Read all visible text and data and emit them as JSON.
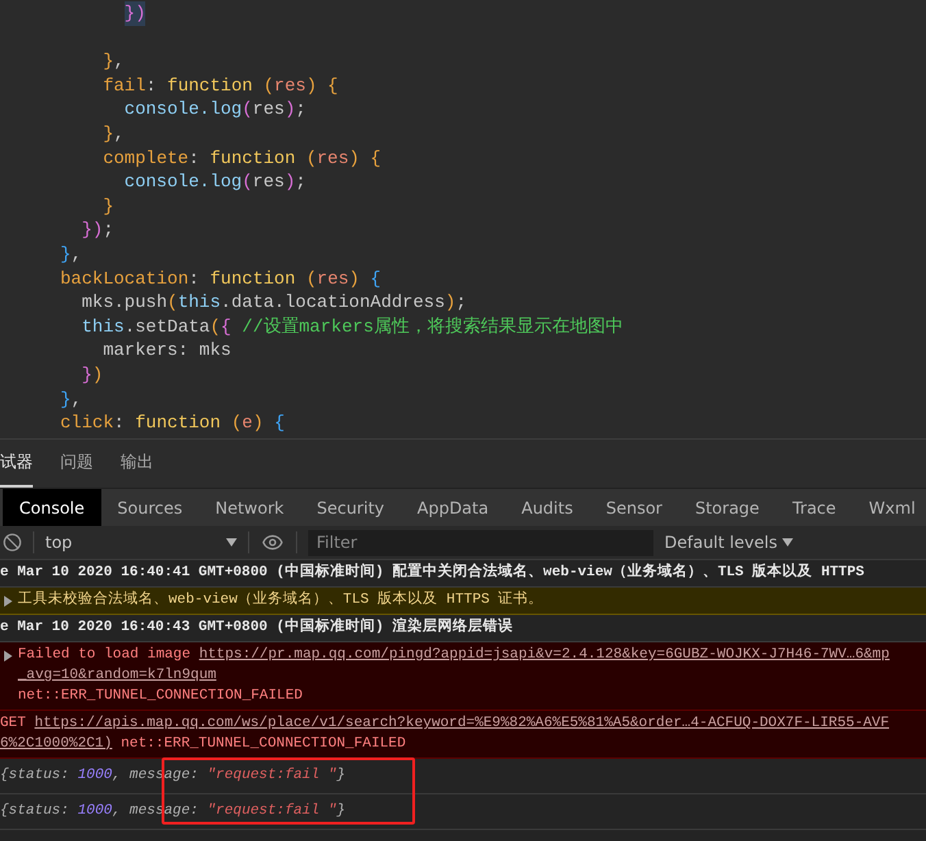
{
  "editor": {
    "lines": [
      {
        "kind": "group",
        "children": [
          {
            "kind": "group",
            "children": [
              {
                "kind": "group",
                "children": [
                  {
                    "kind": "code",
                    "highlighted": true,
                    "tokens": [
                      {
                        "kind": "bracket2",
                        "text": "})"
                      }
                    ]
                  }
                ]
              },
              {
                "kind": "blank"
              },
              {
                "kind": "code",
                "tokens": [
                  {
                    "kind": "bracket1",
                    "text": "}"
                  },
                  {
                    "kind": "punct",
                    "text": ","
                  }
                ]
              },
              {
                "kind": "code",
                "tokens": [
                  {
                    "kind": "prop",
                    "text": "fail"
                  },
                  {
                    "kind": "punct",
                    "text": ": "
                  },
                  {
                    "kind": "keyword",
                    "text": "function "
                  },
                  {
                    "kind": "bracket1",
                    "text": "("
                  },
                  {
                    "kind": "param",
                    "text": "res"
                  },
                  {
                    "kind": "bracket1",
                    "text": ") {"
                  }
                ],
                "children": [
                  {
                    "kind": "code",
                    "tokens": [
                      {
                        "kind": "ident",
                        "text": "console.log"
                      },
                      {
                        "kind": "bracket2",
                        "text": "("
                      },
                      {
                        "kind": "plain",
                        "text": "res"
                      },
                      {
                        "kind": "bracket2",
                        "text": ")"
                      },
                      {
                        "kind": "punct",
                        "text": ";"
                      }
                    ]
                  }
                ]
              },
              {
                "kind": "code",
                "tokens": [
                  {
                    "kind": "bracket1",
                    "text": "}"
                  },
                  {
                    "kind": "punct",
                    "text": ","
                  }
                ]
              },
              {
                "kind": "code",
                "tokens": [
                  {
                    "kind": "prop",
                    "text": "complete"
                  },
                  {
                    "kind": "punct",
                    "text": ": "
                  },
                  {
                    "kind": "keyword",
                    "text": "function "
                  },
                  {
                    "kind": "bracket1",
                    "text": "("
                  },
                  {
                    "kind": "param",
                    "text": "res"
                  },
                  {
                    "kind": "bracket1",
                    "text": ") {"
                  }
                ],
                "children": [
                  {
                    "kind": "code",
                    "tokens": [
                      {
                        "kind": "ident",
                        "text": "console.log"
                      },
                      {
                        "kind": "bracket2",
                        "text": "("
                      },
                      {
                        "kind": "plain",
                        "text": "res"
                      },
                      {
                        "kind": "bracket2",
                        "text": ")"
                      },
                      {
                        "kind": "punct",
                        "text": ";"
                      }
                    ]
                  }
                ]
              },
              {
                "kind": "code",
                "tokens": [
                  {
                    "kind": "bracket1",
                    "text": "}"
                  }
                ]
              }
            ]
          },
          {
            "kind": "code",
            "tokens": [
              {
                "kind": "bracket2",
                "text": "})"
              },
              {
                "kind": "punct",
                "text": ";"
              }
            ]
          }
        ]
      },
      {
        "kind": "code",
        "tokens": [
          {
            "kind": "bracket3",
            "text": "}"
          },
          {
            "kind": "punct",
            "text": ","
          }
        ]
      },
      {
        "kind": "code",
        "tokens": [
          {
            "kind": "prop",
            "text": "backLocation"
          },
          {
            "kind": "punct",
            "text": ": "
          },
          {
            "kind": "keyword",
            "text": "function "
          },
          {
            "kind": "bracket1",
            "text": "("
          },
          {
            "kind": "param",
            "text": "res"
          },
          {
            "kind": "bracket1",
            "text": ") "
          },
          {
            "kind": "bracket3",
            "text": "{"
          }
        ],
        "children": [
          {
            "kind": "code",
            "tokens": [
              {
                "kind": "plain",
                "text": "mks.push"
              },
              {
                "kind": "bracket1",
                "text": "("
              },
              {
                "kind": "ident",
                "text": "this"
              },
              {
                "kind": "plain",
                "text": ".data.locationAddress"
              },
              {
                "kind": "bracket1",
                "text": ")"
              },
              {
                "kind": "punct",
                "text": ";"
              }
            ]
          },
          {
            "kind": "code",
            "tokens": [
              {
                "kind": "ident",
                "text": "this"
              },
              {
                "kind": "plain",
                "text": ".setData"
              },
              {
                "kind": "bracket1",
                "text": "("
              },
              {
                "kind": "bracket2",
                "text": "{ "
              },
              {
                "kind": "comment",
                "text": "//设置markers属性，将搜索结果显示在地图中"
              }
            ],
            "children": [
              {
                "kind": "code",
                "tokens": [
                  {
                    "kind": "plain",
                    "text": "markers: mks"
                  }
                ]
              }
            ]
          },
          {
            "kind": "code",
            "tokens": [
              {
                "kind": "bracket2",
                "text": "}"
              },
              {
                "kind": "bracket1",
                "text": ")"
              }
            ]
          }
        ]
      },
      {
        "kind": "code",
        "tokens": [
          {
            "kind": "bracket3",
            "text": "}"
          },
          {
            "kind": "punct",
            "text": ","
          }
        ]
      },
      {
        "kind": "code",
        "tokens": [
          {
            "kind": "prop",
            "text": "click"
          },
          {
            "kind": "punct",
            "text": ": "
          },
          {
            "kind": "keyword",
            "text": "function "
          },
          {
            "kind": "bracket1",
            "text": "("
          },
          {
            "kind": "param",
            "text": "e"
          },
          {
            "kind": "bracket1",
            "text": ") "
          },
          {
            "kind": "bracket3",
            "text": "{"
          }
        ]
      }
    ]
  },
  "panel_tabs": [
    {
      "label": "试器",
      "selected": true
    },
    {
      "label": "问题",
      "selected": false
    },
    {
      "label": "输出",
      "selected": false
    }
  ],
  "devtools_tabs": [
    {
      "label": "Console",
      "selected": true
    },
    {
      "label": "Sources",
      "selected": false
    },
    {
      "label": "Network",
      "selected": false
    },
    {
      "label": "Security",
      "selected": false
    },
    {
      "label": "AppData",
      "selected": false
    },
    {
      "label": "Audits",
      "selected": false
    },
    {
      "label": "Sensor",
      "selected": false
    },
    {
      "label": "Storage",
      "selected": false
    },
    {
      "label": "Trace",
      "selected": false
    },
    {
      "label": "Wxml",
      "selected": false
    }
  ],
  "toolbar": {
    "context": "top",
    "filter_placeholder": "Filter",
    "levels": "Default levels"
  },
  "messages": [
    {
      "kind": "info",
      "expandable": false,
      "lines": [
        [
          {
            "kind": "text",
            "text": "e Mar 10 2020 16:40:41 GMT+0800 (中国标准时间) 配置中关闭合法域名、web-view（业务域名）、TLS 版本以及 HTTPS"
          }
        ]
      ]
    },
    {
      "kind": "warning",
      "expandable": true,
      "lines": [
        [
          {
            "kind": "text",
            "text": "工具未校验合法域名、web-view（业务域名）、TLS 版本以及 HTTPS 证书。"
          }
        ]
      ]
    },
    {
      "kind": "info",
      "expandable": false,
      "lines": [
        [
          {
            "kind": "text",
            "text": "e Mar 10 2020 16:40:43 GMT+0800 (中国标准时间) 渲染层网络层错误"
          }
        ]
      ]
    },
    {
      "kind": "error",
      "expandable": true,
      "lines": [
        [
          {
            "kind": "text",
            "text": "Failed to load image "
          },
          {
            "kind": "link",
            "text": "https://pr.map.qq.com/pingd?appid=jsapi&v=2.4.128&key=6GUBZ-WOJKX-J7H46-7WV…6&mp"
          }
        ],
        [
          {
            "kind": "link",
            "text": "_avg=10&random=k7ln9qum"
          }
        ],
        [
          {
            "kind": "text",
            "text": "net::ERR_TUNNEL_CONNECTION_FAILED"
          }
        ]
      ]
    },
    {
      "kind": "error",
      "expandable": false,
      "lines": [
        [
          {
            "kind": "text",
            "text": "GET "
          },
          {
            "kind": "link",
            "text": "https://apis.map.qq.com/ws/place/v1/search?keyword=%E9%82%A6%E5%81%A5&order…4-ACFUQ-DOX7F-LIR55-AVF"
          }
        ],
        [
          {
            "kind": "link",
            "text": "6%2C1000%2C1)"
          },
          {
            "kind": "text",
            "text": " net::ERR_TUNNEL_CONNECTION_FAILED"
          }
        ]
      ]
    },
    {
      "kind": "log",
      "expandable": false,
      "lines": [
        [
          {
            "kind": "key",
            "text": "{status: "
          },
          {
            "kind": "number",
            "text": "1000"
          },
          {
            "kind": "key",
            "text": ", message: "
          },
          {
            "kind": "string",
            "text": "\"request:fail \""
          },
          {
            "kind": "key",
            "text": "}"
          }
        ]
      ]
    },
    {
      "kind": "log",
      "expandable": false,
      "lines": [
        [
          {
            "kind": "key",
            "text": "{status: "
          },
          {
            "kind": "number",
            "text": "1000"
          },
          {
            "kind": "key",
            "text": ", message: "
          },
          {
            "kind": "string",
            "text": "\"request:fail \""
          },
          {
            "kind": "key",
            "text": "}"
          }
        ]
      ]
    }
  ]
}
